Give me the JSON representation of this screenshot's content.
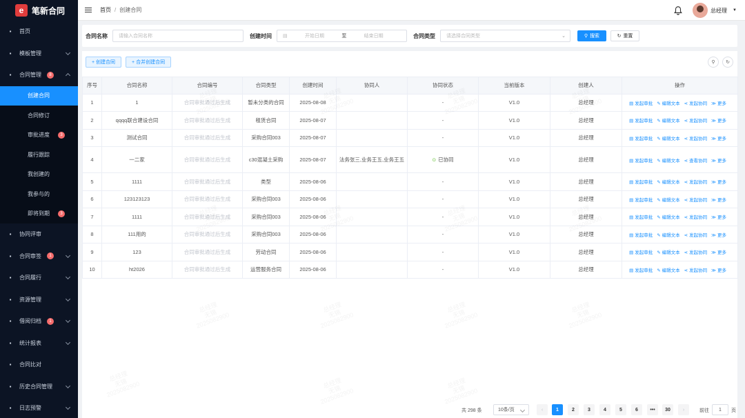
{
  "app": {
    "logo_glyph": "e",
    "name": "笔新合同"
  },
  "sidebar": {
    "items": [
      {
        "label": "首页",
        "icon": "dashboard-icon"
      },
      {
        "label": "模板管理",
        "icon": "template-icon",
        "arrow": "down"
      },
      {
        "label": "合同管理",
        "icon": "edit-icon",
        "badge": "8",
        "arrow": "up"
      }
    ],
    "subitems": [
      {
        "label": "创建合同",
        "active": true
      },
      {
        "label": "合同修订"
      },
      {
        "label": "审批进度",
        "badge": "3"
      },
      {
        "label": "履行跟踪"
      },
      {
        "label": "我创建的"
      },
      {
        "label": "我参与的"
      },
      {
        "label": "即将到期",
        "badge": "3"
      }
    ],
    "items2": [
      {
        "label": "协同评审",
        "icon": "collab-icon"
      },
      {
        "label": "合同审签",
        "icon": "sign-icon",
        "badge": "1",
        "arrow": "down"
      },
      {
        "label": "合同履行",
        "icon": "perform-icon",
        "arrow": "down"
      },
      {
        "label": "资源管理",
        "icon": "grid-icon",
        "arrow": "down"
      },
      {
        "label": "借阅归档",
        "icon": "archive-icon",
        "badge": "1",
        "arrow": "down"
      },
      {
        "label": "统计报表",
        "icon": "chart-icon",
        "arrow": "down"
      },
      {
        "label": "合同比对",
        "icon": "compare-icon"
      },
      {
        "label": "历史合同管理",
        "icon": "history-icon",
        "arrow": "down"
      },
      {
        "label": "日志预警",
        "icon": "log-icon",
        "arrow": "down"
      }
    ]
  },
  "header": {
    "breadcrumb_home": "首页",
    "breadcrumb_sep": "/",
    "breadcrumb_current": "创建合同",
    "username": "总经理"
  },
  "search": {
    "name_label": "合同名称",
    "name_placeholder": "请输入合同名称",
    "time_label": "创建时间",
    "start_placeholder": "开始日期",
    "to": "至",
    "end_placeholder": "结束日期",
    "type_label": "合同类型",
    "type_placeholder": "请选择合同类型",
    "search_btn": "搜索",
    "reset_btn": "重置"
  },
  "toolbar": {
    "create_btn": "+ 创建合同",
    "merge_btn": "+ 合并创建合同"
  },
  "table": {
    "headers": [
      "序号",
      "合同名称",
      "合同编号",
      "合同类型",
      "创建时间",
      "协同人",
      "协同状态",
      "当前版本",
      "创建人",
      "操作"
    ],
    "rows": [
      {
        "no": "1",
        "name": "1",
        "code": "合同审批通过后生成",
        "type": "暂未分类的合同",
        "time": "2025-08-08",
        "collab": "",
        "status": "-",
        "version": "V1.0",
        "creator": "总经理",
        "op3": "发起协同"
      },
      {
        "no": "2",
        "name": "qqqq联合建设合同",
        "code": "合同审批通过后生成",
        "type": "租赁合同",
        "time": "2025-08-07",
        "collab": "",
        "status": "-",
        "version": "V1.0",
        "creator": "总经理",
        "op3": "发起协同"
      },
      {
        "no": "3",
        "name": "测试合同",
        "code": "合同审批通过后生成",
        "type": "采购合同003",
        "time": "2025-08-07",
        "collab": "",
        "status": "-",
        "version": "V1.0",
        "creator": "总经理",
        "op3": "发起协同"
      },
      {
        "no": "4",
        "name": "一二家",
        "code": "合同审批通过后生成",
        "type": "c30混凝土采购",
        "time": "2025-08-07",
        "collab": "法务张三,业务王五,业务王五",
        "status": "已协同",
        "version": "V1.0",
        "creator": "总经理",
        "op3": "查看协同"
      },
      {
        "no": "5",
        "name": "1111",
        "code": "合同审批通过后生成",
        "type": "类型",
        "time": "2025-08-06",
        "collab": "",
        "status": "-",
        "version": "V1.0",
        "creator": "总经理",
        "op3": "发起协同"
      },
      {
        "no": "6",
        "name": "123123123",
        "code": "合同审批通过后生成",
        "type": "采购合同003",
        "time": "2025-08-06",
        "collab": "",
        "status": "-",
        "version": "V1.0",
        "creator": "总经理",
        "op3": "发起协同"
      },
      {
        "no": "7",
        "name": "1111",
        "code": "合同审批通过后生成",
        "type": "采购合同003",
        "time": "2025-08-06",
        "collab": "",
        "status": "-",
        "version": "V1.0",
        "creator": "总经理",
        "op3": "发起协同"
      },
      {
        "no": "8",
        "name": "111用的",
        "code": "合同审批通过后生成",
        "type": "采购合同003",
        "time": "2025-08-06",
        "collab": "",
        "status": "-",
        "version": "V1.0",
        "creator": "总经理",
        "op3": "发起协同"
      },
      {
        "no": "9",
        "name": "123",
        "code": "合同审批通过后生成",
        "type": "劳动合同",
        "time": "2025-08-06",
        "collab": "",
        "status": "-",
        "version": "V1.0",
        "creator": "总经理",
        "op3": "发起协同"
      },
      {
        "no": "10",
        "name": "ht2026",
        "code": "合同审批通过后生成",
        "type": "运营服务合同",
        "time": "2025-08-06",
        "collab": "",
        "status": "-",
        "version": "V1.0",
        "creator": "总经理",
        "op3": "发起协同"
      }
    ],
    "op_labels": {
      "approve": "发起审批",
      "edit": "编辑文本",
      "more": "更多"
    }
  },
  "pagination": {
    "total": "共 298 条",
    "page_size": "10条/页",
    "pages": [
      "1",
      "2",
      "3",
      "4",
      "5",
      "6",
      "•••",
      "30"
    ],
    "current": "1",
    "goto_label": "前往",
    "goto_value": "1",
    "page_word": "页"
  },
  "watermark": {
    "line1": "总经理",
    "line2": "无锡",
    "line3": "2025082900"
  },
  "colors": {
    "sidebar_bg": "#0c1424",
    "primary": "#1890ff",
    "badge": "#f56c6c",
    "logo": "#e03c3c"
  }
}
